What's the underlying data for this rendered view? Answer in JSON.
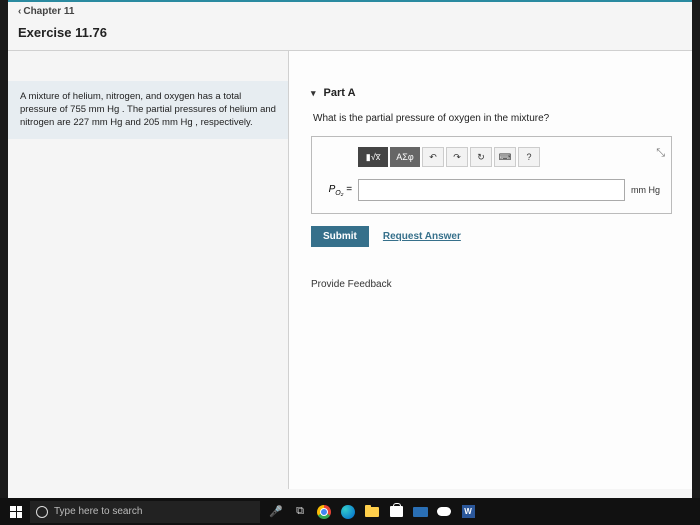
{
  "nav": {
    "back": "Chapter 11"
  },
  "exercise": {
    "title": "Exercise 11.76"
  },
  "problem": {
    "text": "A mixture of helium, nitrogen, and oxygen has a total pressure of 755 mm Hg . The partial pressures of helium and nitrogen are 227 mm Hg and 205 mm Hg , respectively."
  },
  "part": {
    "label": "Part A",
    "question": "What is the partial pressure of oxygen in the mixture?",
    "toolbar": {
      "templates": "▮√x̅",
      "greek": "ΑΣφ",
      "undo": "↶",
      "redo": "↷",
      "reset": "↻",
      "keyboard": "⌨",
      "help": "?"
    },
    "variable": "P",
    "subscript": "O₂",
    "equals": "=",
    "value": "",
    "unit": "mm Hg",
    "submit": "Submit",
    "request": "Request Answer"
  },
  "feedback": "Provide Feedback",
  "taskbar": {
    "search_placeholder": "Type here to search",
    "word": "W"
  }
}
